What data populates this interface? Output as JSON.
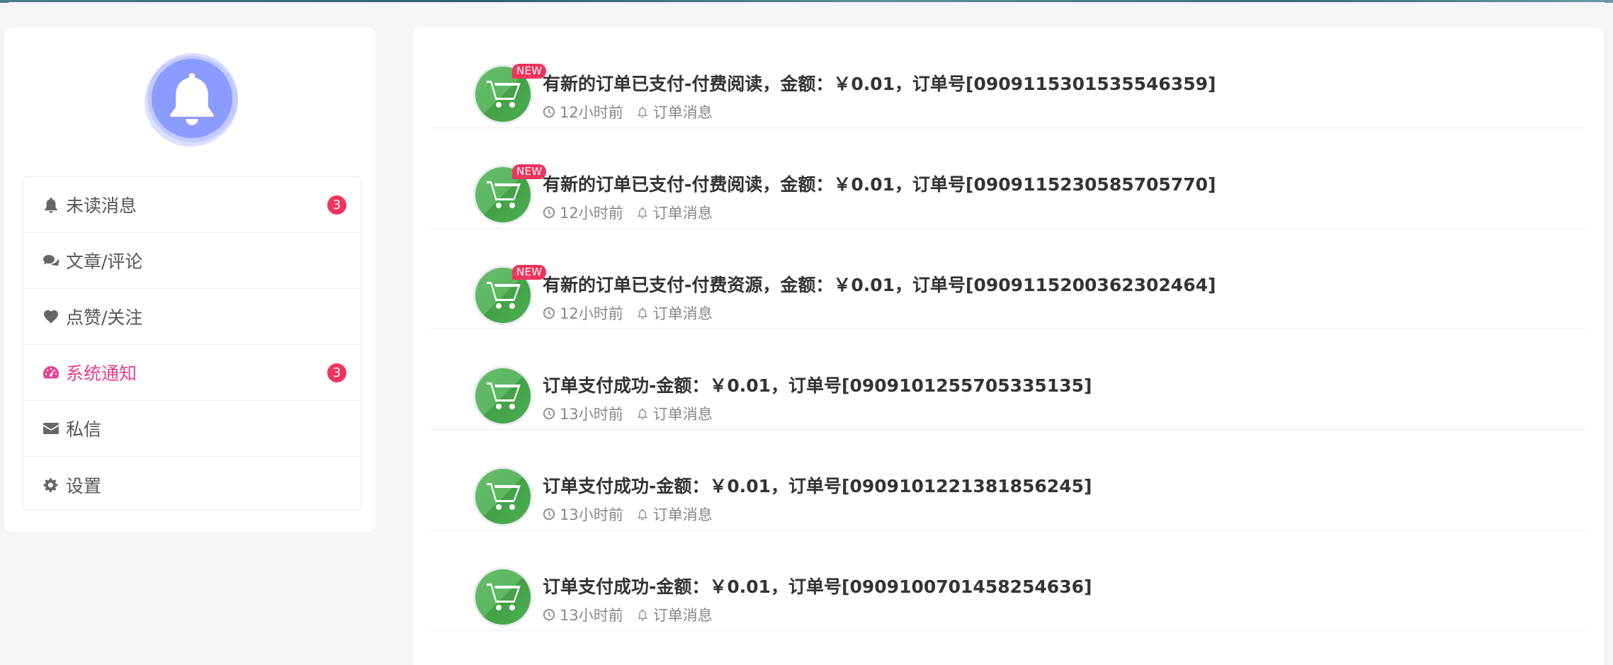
{
  "colors": {
    "accent": "#e83e8c",
    "badge": "#f0345b",
    "avatar_bell": "#8c9bff",
    "order_icon": "#4caf50"
  },
  "sidebar": {
    "avatar_icon": "bell-icon",
    "items": [
      {
        "label": "未读消息",
        "icon": "bell-icon",
        "badge": "3",
        "active": false
      },
      {
        "label": "文章/评论",
        "icon": "comments-icon",
        "badge": "",
        "active": false
      },
      {
        "label": "点赞/关注",
        "icon": "heart-icon",
        "badge": "",
        "active": false
      },
      {
        "label": "系统通知",
        "icon": "dashboard-icon",
        "badge": "3",
        "active": true
      },
      {
        "label": "私信",
        "icon": "envelope-icon",
        "badge": "",
        "active": false
      },
      {
        "label": "设置",
        "icon": "gear-icon",
        "badge": "",
        "active": false
      }
    ]
  },
  "messages": [
    {
      "is_new": true,
      "new_label": "NEW",
      "title": "有新的订单已支付-付费阅读，金额：￥0.01，订单号[0909115301535546359]",
      "time": "12小时前",
      "category": "订单消息",
      "icon": "cart-icon"
    },
    {
      "is_new": true,
      "new_label": "NEW",
      "title": "有新的订单已支付-付费阅读，金额：￥0.01，订单号[0909115230585705770]",
      "time": "12小时前",
      "category": "订单消息",
      "icon": "cart-icon"
    },
    {
      "is_new": true,
      "new_label": "NEW",
      "title": "有新的订单已支付-付费资源，金额：￥0.01，订单号[0909115200362302464]",
      "time": "12小时前",
      "category": "订单消息",
      "icon": "cart-icon"
    },
    {
      "is_new": false,
      "new_label": "",
      "title": "订单支付成功-金额：￥0.01，订单号[0909101255705335135]",
      "time": "13小时前",
      "category": "订单消息",
      "icon": "cart-icon"
    },
    {
      "is_new": false,
      "new_label": "",
      "title": "订单支付成功-金额：￥0.01，订单号[0909101221381856245]",
      "time": "13小时前",
      "category": "订单消息",
      "icon": "cart-icon"
    },
    {
      "is_new": false,
      "new_label": "",
      "title": "订单支付成功-金额：￥0.01，订单号[0909100701458254636]",
      "time": "13小时前",
      "category": "订单消息",
      "icon": "cart-icon"
    }
  ]
}
